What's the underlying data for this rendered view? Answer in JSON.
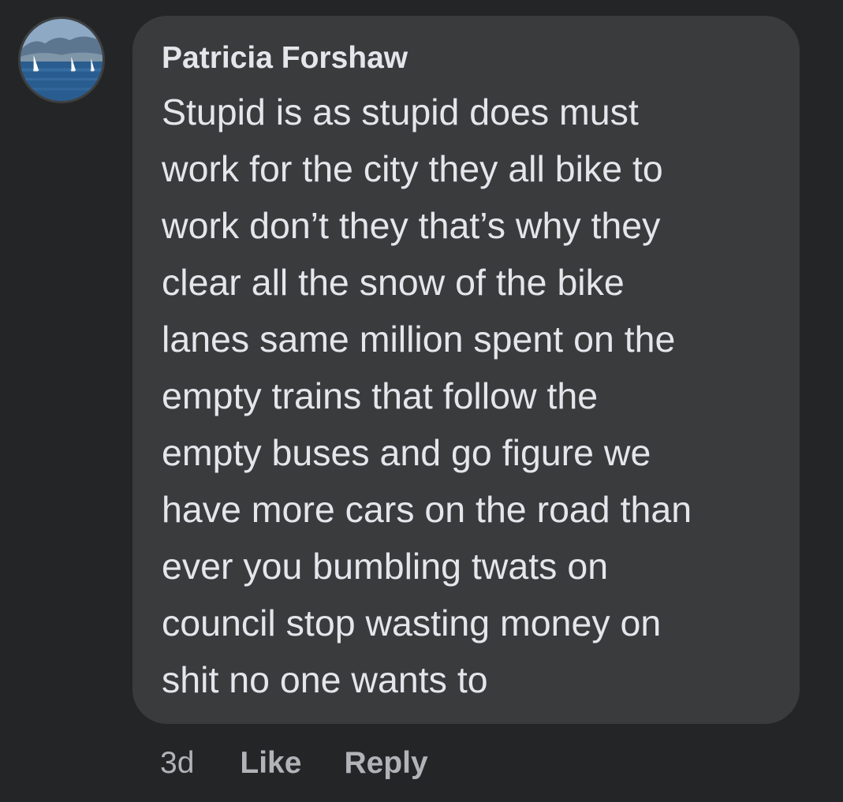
{
  "comment": {
    "author": "Patricia Forshaw",
    "avatar_icon": "avatar-sailboats-lake-photo",
    "text_lines": [
      "Stupid is as stupid does  must",
      "work for the city they all bike to",
      "work don’t they that’s why they",
      "clear all the snow of the bike",
      "lanes same million spent on the",
      "empty trains that follow the",
      "empty buses and go figure we",
      "have more cars on the road than",
      "ever you bumbling twats on",
      "council stop wasting money on",
      "shit no one wants to"
    ],
    "timestamp": "3d",
    "like_label": "Like",
    "reply_label": "Reply"
  },
  "colors": {
    "background": "#242526",
    "bubble": "#3a3b3c",
    "text_primary": "#e4e6eb",
    "text_secondary": "#b0b3b8"
  }
}
